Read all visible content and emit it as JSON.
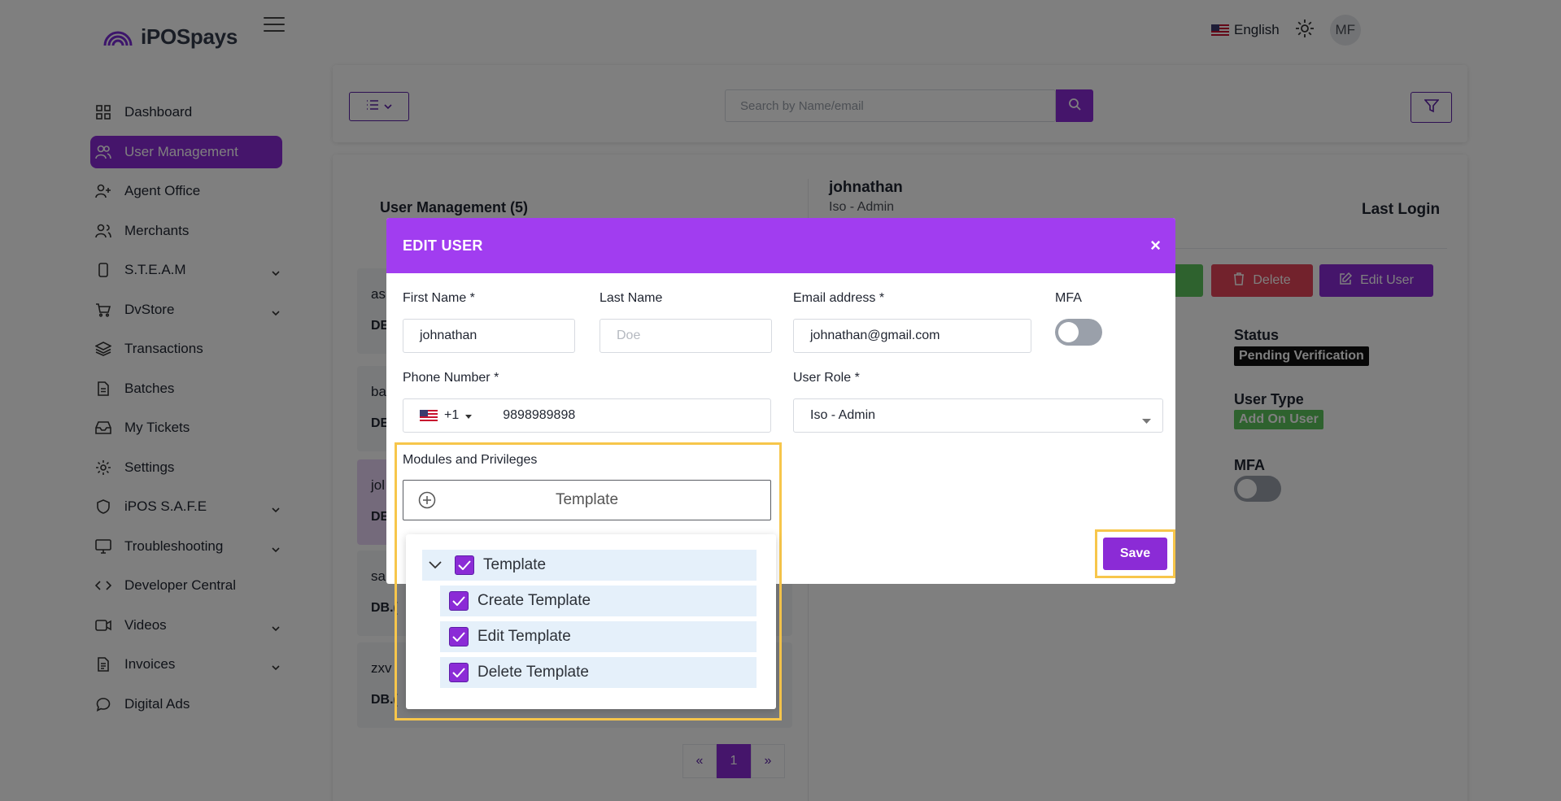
{
  "app": {
    "brand": "iPOSpays",
    "language": "English",
    "user_initials": "MF"
  },
  "sidebar": {
    "items": [
      {
        "label": "Dashboard",
        "icon": "grid-icon"
      },
      {
        "label": "User Management",
        "icon": "users-icon"
      },
      {
        "label": "Agent Office",
        "icon": "user-plus-icon"
      },
      {
        "label": "Merchants",
        "icon": "merchants-icon"
      },
      {
        "label": "S.T.E.A.M",
        "icon": "phone-icon"
      },
      {
        "label": "DvStore",
        "icon": "cart-icon"
      },
      {
        "label": "Transactions",
        "icon": "layers-icon"
      },
      {
        "label": "Batches",
        "icon": "file-icon"
      },
      {
        "label": "My Tickets",
        "icon": "inbox-icon"
      },
      {
        "label": "Settings",
        "icon": "gear-icon"
      },
      {
        "label": "iPOS S.A.F.E",
        "icon": "shield-icon"
      },
      {
        "label": "Troubleshooting",
        "icon": "monitor-icon"
      },
      {
        "label": "Developer Central",
        "icon": "code-icon"
      },
      {
        "label": "Videos",
        "icon": "video-icon"
      },
      {
        "label": "Invoices",
        "icon": "invoice-icon"
      },
      {
        "label": "Digital Ads",
        "icon": "chat-icon"
      }
    ]
  },
  "toolbar": {
    "search_placeholder": "Search by Name/email"
  },
  "main": {
    "title": "User Management (5)",
    "list": [
      {
        "name": "as",
        "sub": "DE"
      },
      {
        "name": "ba",
        "sub": "DE"
      },
      {
        "name": "jol",
        "sub": "DE"
      },
      {
        "name": "sa",
        "sub": "DB.("
      },
      {
        "name": "zxv",
        "sub": "DB.("
      }
    ],
    "detail": {
      "name": "johnathan",
      "role": "Iso - Admin",
      "last_login_label": "Last Login",
      "delete_label": "Delete",
      "edit_label": "Edit User",
      "status_label": "Status",
      "status_value": "Pending Verification",
      "user_type_label": "User Type",
      "user_type_value": "Add On User",
      "mfa_label": "MFA"
    },
    "pager": {
      "prev": "«",
      "current": "1",
      "next": "»"
    }
  },
  "modal": {
    "title": "EDIT USER",
    "close": "×",
    "first_name_label": "First Name *",
    "first_name_value": "johnathan",
    "last_name_label": "Last Name",
    "last_name_placeholder": "Doe",
    "email_label": "Email address *",
    "email_value": "johnathan@gmail.com",
    "mfa_label": "MFA",
    "phone_label": "Phone Number *",
    "phone_code": "+1",
    "phone_value": "9898989898",
    "role_label": "User Role *",
    "role_value": "Iso - Admin",
    "modules_label": "Modules and Privileges",
    "template_button": "Template",
    "save_label": "Save"
  },
  "tree": {
    "root": "Template",
    "children": [
      "Create Template",
      "Edit Template",
      "Delete Template"
    ]
  },
  "colors": {
    "accent": "#8b2bd6",
    "modal_header": "#a13df0",
    "highlight": "#f7c64b",
    "delete": "#e54558",
    "success": "#5cc45c"
  }
}
